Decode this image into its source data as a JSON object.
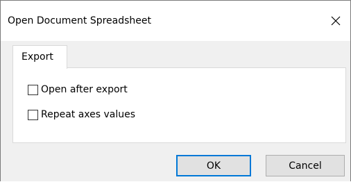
{
  "dialog": {
    "title": "Open Document Spreadsheet",
    "close_icon": "close-x-icon"
  },
  "tabs": [
    {
      "label": "Export",
      "selected": true
    }
  ],
  "options": [
    {
      "label": "Open after export",
      "checked": false
    },
    {
      "label": "Repeat axes values",
      "checked": false
    }
  ],
  "buttons": {
    "ok_label": "OK",
    "cancel_label": "Cancel"
  },
  "colors": {
    "focus_border": "#0078d7",
    "button_face": "#e1e1e1",
    "dialog_background": "#f0f0f0"
  }
}
